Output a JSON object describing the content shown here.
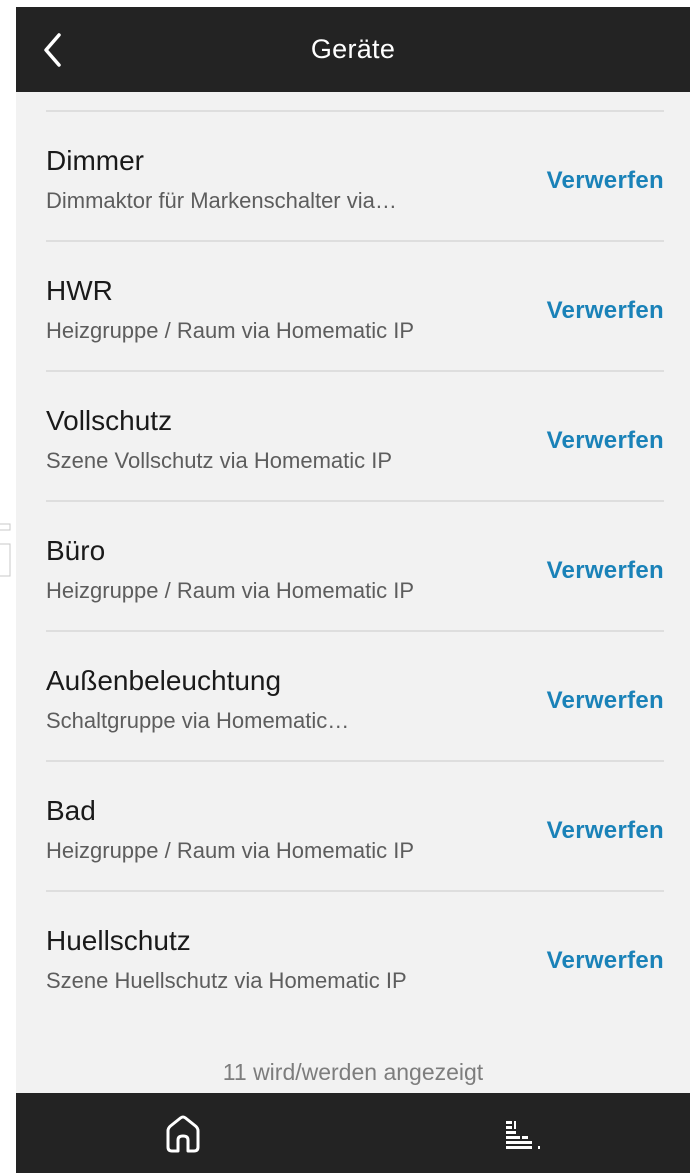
{
  "header": {
    "title": "Geräte",
    "back_icon": "chevron-left-icon"
  },
  "devices": [
    {
      "name": "Dimmer",
      "description": "Dimmaktor für Markenschalter via…",
      "action": "Verwerfen"
    },
    {
      "name": "HWR",
      "description": "Heizgruppe / Raum via Homematic IP",
      "action": "Verwerfen"
    },
    {
      "name": "Vollschutz",
      "description": "Szene Vollschutz via Homematic IP",
      "action": "Verwerfen"
    },
    {
      "name": "Büro",
      "description": "Heizgruppe / Raum via Homematic IP",
      "action": "Verwerfen"
    },
    {
      "name": "Außenbeleuchtung",
      "description": "Schaltgruppe via Homematic…",
      "action": "Verwerfen"
    },
    {
      "name": "Bad",
      "description": "Heizgruppe / Raum via Homematic IP",
      "action": "Verwerfen"
    },
    {
      "name": "Huellschutz",
      "description": "Szene Huellschutz via Homematic IP",
      "action": "Verwerfen"
    }
  ],
  "footer": {
    "count_text": "11 wird/werden angezeigt"
  },
  "bottom_nav": {
    "items": [
      {
        "icon": "home-icon"
      },
      {
        "icon": "activity-icon"
      }
    ]
  },
  "colors": {
    "bar_background": "#232323",
    "page_background": "#f2f2f2",
    "action": "#1a82b8",
    "divider": "#dedede"
  }
}
